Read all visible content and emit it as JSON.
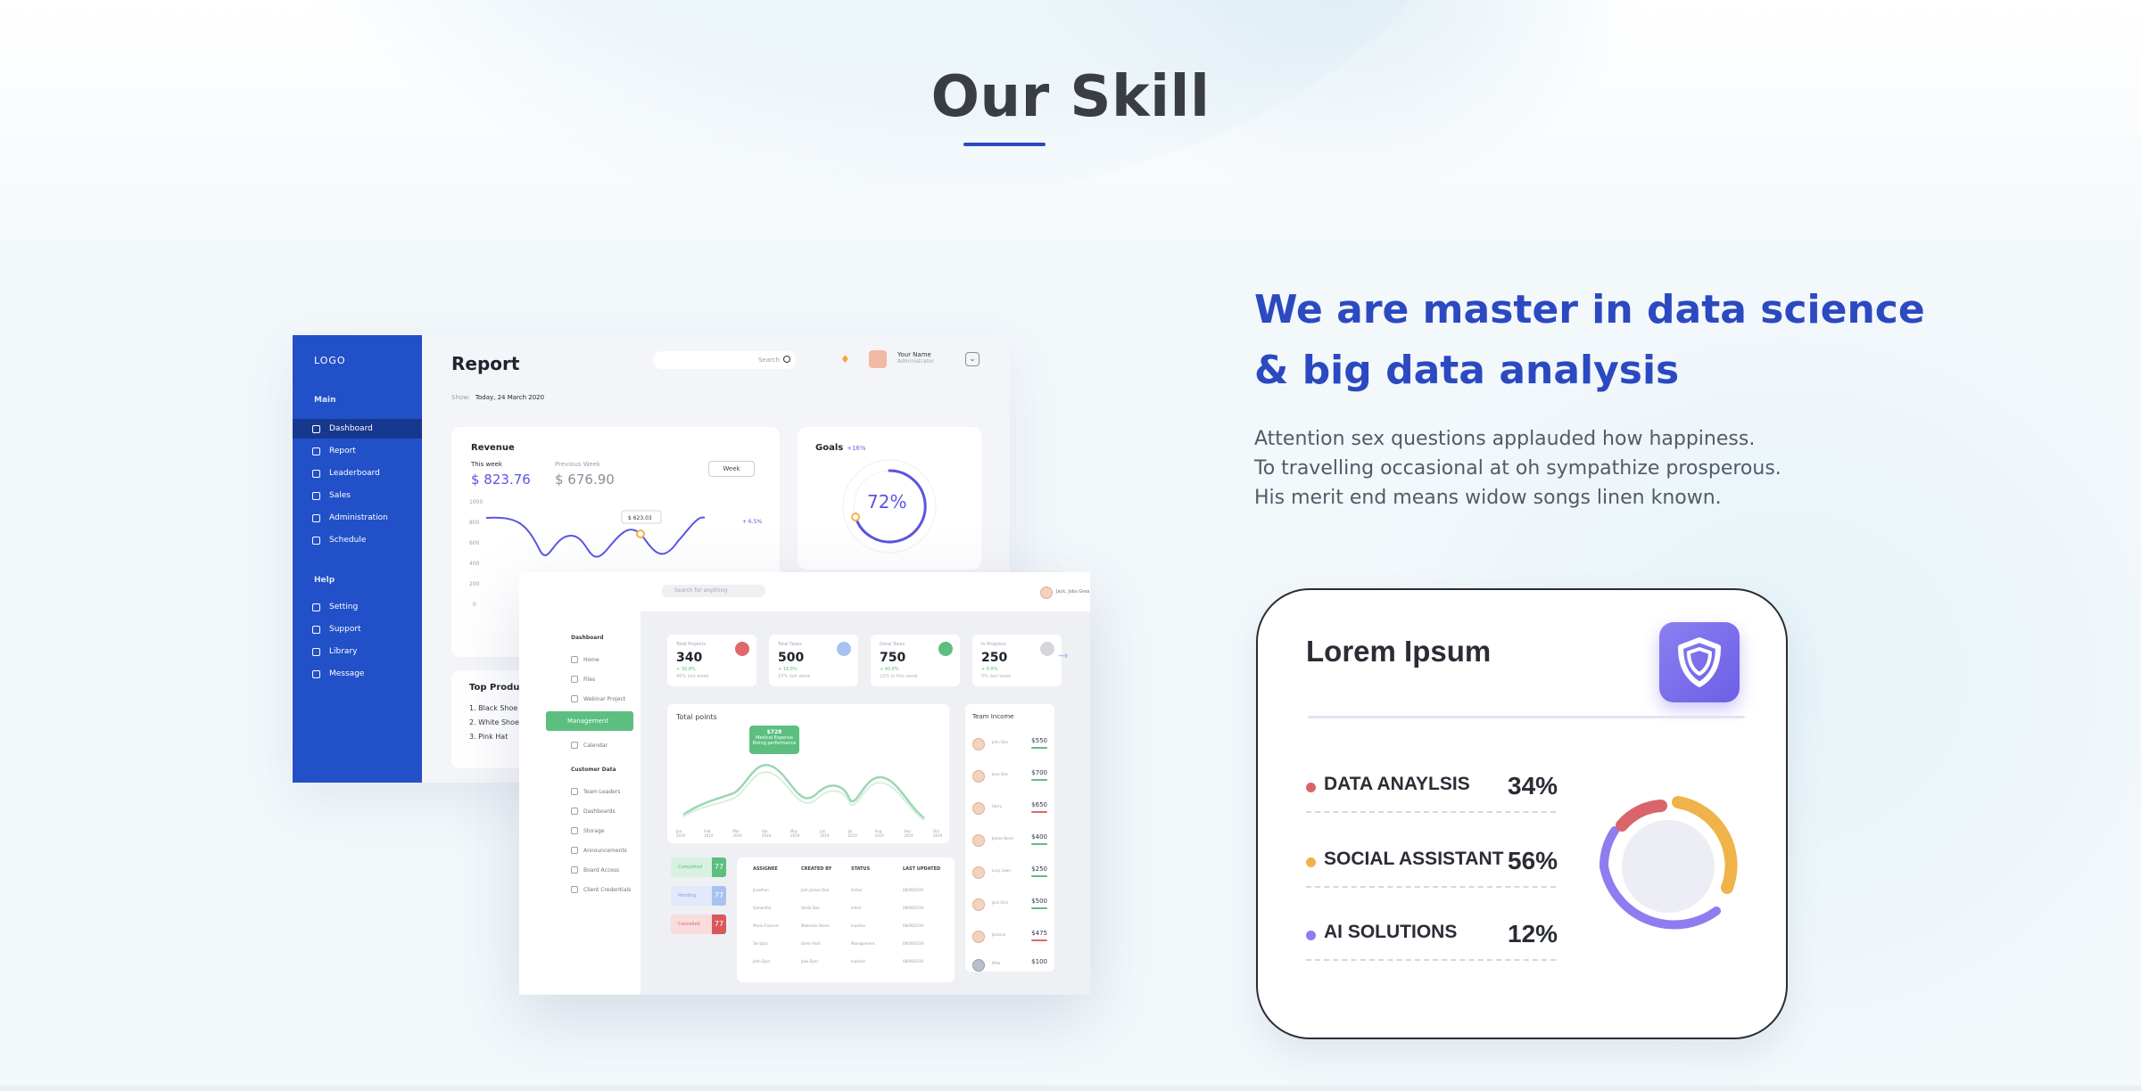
{
  "section": {
    "title": "Our Skill"
  },
  "headline": {
    "line1": "We are master in data science",
    "line2": "& big data analysis"
  },
  "paragraph": {
    "line1": "Attention sex questions applauded how happiness.",
    "line2": "To travelling occasional at oh sympathize prosperous.",
    "line3": "His merit end means widow songs linen known."
  },
  "skill_card": {
    "title": "Lorem Ipsum",
    "badge_icon": "shield-icon",
    "skills": [
      {
        "name": "DATA ANAYLSIS",
        "percent": "34%",
        "color": "#d9656a"
      },
      {
        "name": "SOCIAL ASSISTANT",
        "percent": "56%",
        "color": "#f0b34a"
      },
      {
        "name": "AI SOLUTIONS",
        "percent": "12%",
        "color": "#8e7cf0"
      }
    ]
  },
  "dashboard_back": {
    "logo": "LOGO",
    "groups": {
      "main": "Main",
      "help": "Help"
    },
    "menu_main": [
      "Dashboard",
      "Report",
      "Leaderboard",
      "Sales",
      "Administration",
      "Schedule"
    ],
    "menu_help": [
      "Setting",
      "Support",
      "Library",
      "Message"
    ],
    "page_title": "Report",
    "search_placeholder": "Search",
    "user_name": "Your Name",
    "user_role": "Administrator",
    "show_label": "Show:",
    "show_value": "Today, 24 March 2020",
    "revenue": {
      "title": "Revenue",
      "this_week_label": "This week",
      "this_week_value": "$ 823.76",
      "prev_week_label": "Previous Week",
      "prev_week_value": "$ 676.90",
      "select": "Week",
      "tooltip": "$ 623.03",
      "y_ticks": [
        "1000",
        "800",
        "600",
        "400",
        "200",
        "0"
      ],
      "badge": "+ 6.5%"
    },
    "goals": {
      "title": "Goals",
      "delta": "+16%",
      "value": "72%"
    },
    "top_products": {
      "title": "Top Products",
      "items": [
        "1. Black Shoe",
        "2. White Shoe",
        "3. Pink Hat"
      ]
    }
  },
  "dashboard_front": {
    "search_placeholder": "Search for anything",
    "user_name": "Jack, Jobs Grea",
    "sidebar": {
      "dashboard": "Dashboard",
      "items1": [
        "Home",
        "Files",
        "Webinar Project"
      ],
      "active": "Management",
      "items2": [
        "Calendar"
      ],
      "customer_data": "Customer Data",
      "items3": [
        "Team Leaders",
        "Dashboards",
        "Storage",
        "Announcements",
        "Board Access",
        "Client Credentials"
      ]
    },
    "stats": [
      {
        "label": "Total Projects",
        "value": "340",
        "change": "+ 30.8%",
        "sub": "40% last week"
      },
      {
        "label": "Total Tasks",
        "value": "500",
        "change": "+ 16.8%",
        "sub": "15% last week"
      },
      {
        "label": "Done Tasks",
        "value": "750",
        "change": "+ 40.8%",
        "sub": "22% in this week"
      },
      {
        "label": "In Progress",
        "value": "250",
        "change": "+ 8.8%",
        "sub": "5% last week"
      }
    ],
    "total_points": {
      "title": "Total points",
      "tooltip_value": "$728",
      "tooltip_sub1": "Medical Expense",
      "tooltip_sub2": "Rising performance",
      "months": [
        "Jan 2019",
        "Feb 2019",
        "Mar 2019",
        "Apr 2019",
        "May 2019",
        "Jun 2019",
        "Jul 2019",
        "Aug 2019",
        "Sep 2019",
        "Oct 2019"
      ]
    },
    "team_income": {
      "title": "Team Income",
      "rows": [
        {
          "name": "John Doe",
          "amount": "$550"
        },
        {
          "name": "Jane Doe",
          "amount": "$700"
        },
        {
          "name": "Harry",
          "amount": "$650"
        },
        {
          "name": "James Bond",
          "amount": "$400"
        },
        {
          "name": "Lucy Lowe",
          "amount": "$250"
        },
        {
          "name": "Jack Shin",
          "amount": "$500"
        },
        {
          "name": "Jackson",
          "amount": "$475"
        },
        {
          "name": "Mike",
          "amount": "$100"
        }
      ]
    },
    "mini_badges": [
      {
        "label": "Completed",
        "num": "77"
      },
      {
        "label": "Pending",
        "num": "77"
      },
      {
        "label": "Cancelled",
        "num": "77"
      }
    ],
    "table": {
      "headers": [
        "ASSIGNEE",
        "CREATED BY",
        "STATUS",
        "LAST UPDATED"
      ],
      "rows": [
        [
          "Jonathan",
          "John James Doe",
          "Active",
          "08/09/2019"
        ],
        [
          "Samantha",
          "Stella Doe",
          "Infect",
          "08/09/2019"
        ],
        [
          "Marie Francois",
          "Makenzie Stone",
          "Inactive",
          "08/09/2019"
        ],
        [
          "Terrazzo",
          "Glenn Park",
          "Management",
          "08/09/2019"
        ],
        [
          "John Dyer",
          "Jake Dyer",
          "Inactive",
          "08/09/2019"
        ]
      ]
    }
  }
}
